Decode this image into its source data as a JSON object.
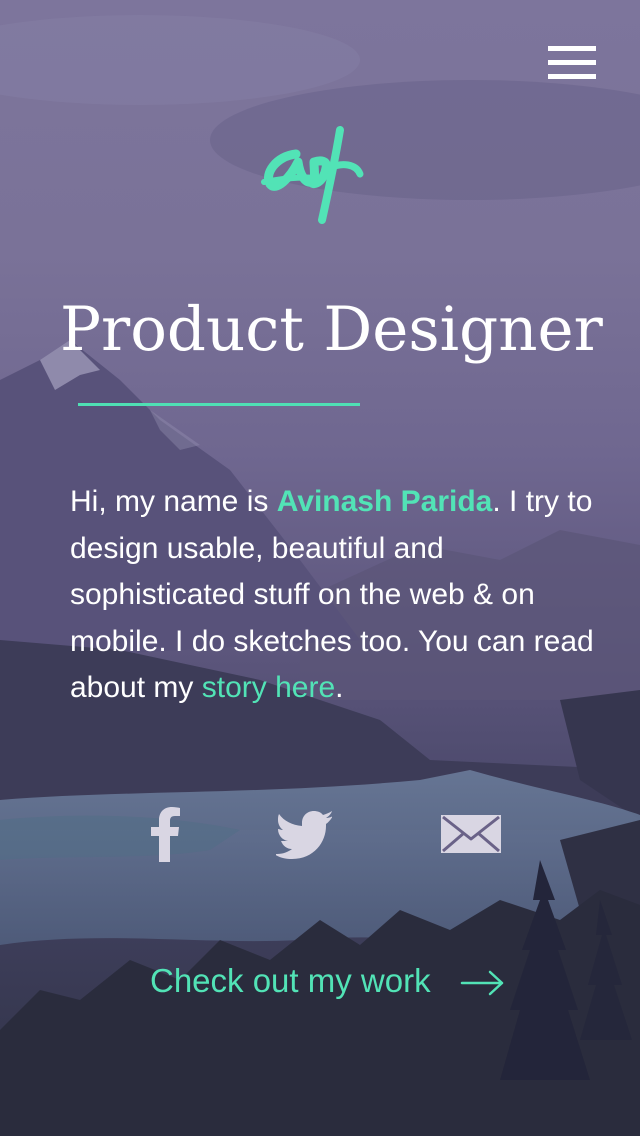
{
  "header": {
    "menu_icon": "hamburger-menu-icon",
    "logo_icon": "ap-monogram-logo"
  },
  "hero": {
    "title": "Product Designer"
  },
  "intro": {
    "text_1": "Hi, my name is ",
    "name": "Avinash Parida",
    "text_2": ". I try to design usable, beautiful and sophisticated stuff on the web & on mobile. I do sketches too. You can read about my ",
    "story_link": "story here",
    "text_3": "."
  },
  "social": {
    "icons": [
      "facebook-icon",
      "twitter-icon",
      "email-icon"
    ]
  },
  "cta": {
    "label": "Check out my work",
    "icon": "arrow-right-icon"
  },
  "colors": {
    "accent": "#52e3b6",
    "text": "#ffffff",
    "overlay": "#7a7298",
    "icon_muted": "#d9d6e3"
  }
}
